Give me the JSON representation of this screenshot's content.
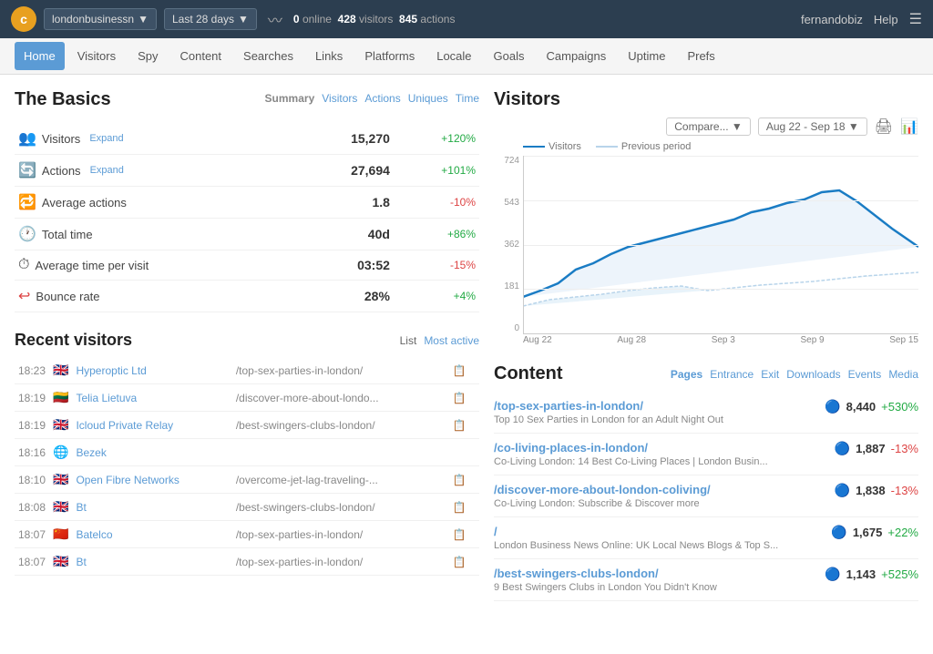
{
  "topnav": {
    "logo": "c",
    "site": "londonbusinessn",
    "date_range": "Last 28 days",
    "online": "0",
    "visitors": "428",
    "actions": "845",
    "online_label": "online",
    "visitors_label": "visitors",
    "actions_label": "actions",
    "user": "fernandobiz",
    "help": "Help"
  },
  "subnav": {
    "items": [
      {
        "label": "Home",
        "active": true
      },
      {
        "label": "Visitors",
        "active": false
      },
      {
        "label": "Spy",
        "active": false
      },
      {
        "label": "Content",
        "active": false
      },
      {
        "label": "Searches",
        "active": false
      },
      {
        "label": "Links",
        "active": false
      },
      {
        "label": "Platforms",
        "active": false
      },
      {
        "label": "Locale",
        "active": false
      },
      {
        "label": "Goals",
        "active": false
      },
      {
        "label": "Campaigns",
        "active": false
      },
      {
        "label": "Uptime",
        "active": false
      },
      {
        "label": "Prefs",
        "active": false
      }
    ]
  },
  "basics": {
    "title": "The Basics",
    "summary_label": "Summary",
    "tabs": [
      "Visitors",
      "Actions",
      "Uniques",
      "Time"
    ],
    "metrics": [
      {
        "icon": "visitors",
        "label": "Visitors",
        "expand": true,
        "value": "15,270",
        "change": "+120%",
        "positive": true
      },
      {
        "icon": "actions",
        "label": "Actions",
        "expand": true,
        "value": "27,694",
        "change": "+101%",
        "positive": true
      },
      {
        "icon": "avg",
        "label": "Average actions",
        "expand": false,
        "value": "1.8",
        "change": "-10%",
        "positive": false
      },
      {
        "icon": "time",
        "label": "Total time",
        "expand": false,
        "value": "40d",
        "change": "+86%",
        "positive": true
      },
      {
        "icon": "time",
        "label": "Average time per visit",
        "expand": false,
        "value": "03:52",
        "change": "-15%",
        "positive": false
      },
      {
        "icon": "bounce",
        "label": "Bounce rate",
        "expand": false,
        "value": "28%",
        "change": "+4%",
        "positive": true
      }
    ]
  },
  "recent_visitors": {
    "title": "Recent visitors",
    "list_label": "List",
    "most_active_label": "Most active",
    "rows": [
      {
        "time": "18:23",
        "flag": "🇬🇧",
        "name": "Hyperoptic Ltd",
        "url": "/top-sex-parties-in-london/"
      },
      {
        "time": "18:19",
        "flag": "🇱🇹",
        "name": "Telia Lietuva",
        "url": "/discover-more-about-londo..."
      },
      {
        "time": "18:19",
        "flag": "🇬🇧",
        "name": "Icloud Private Relay",
        "url": "/best-swingers-clubs-london/"
      },
      {
        "time": "18:16",
        "flag": "🌐",
        "name": "Bezek",
        "url": ""
      },
      {
        "time": "18:10",
        "flag": "🇬🇧",
        "name": "Open Fibre Networks",
        "url": "/overcome-jet-lag-traveling-..."
      },
      {
        "time": "18:08",
        "flag": "🇬🇧",
        "name": "Bt",
        "url": "/best-swingers-clubs-london/"
      },
      {
        "time": "18:07",
        "flag": "🇨🇳",
        "name": "Batelco",
        "url": "/top-sex-parties-in-london/"
      },
      {
        "time": "18:07",
        "flag": "🇬🇧",
        "name": "Bt",
        "url": "/top-sex-parties-in-london/"
      }
    ]
  },
  "visitors_chart": {
    "title": "Visitors",
    "compare_label": "Compare...",
    "date_range": "Aug 22 - Sep 18",
    "legend_visitors": "Visitors",
    "legend_prev": "Previous period",
    "y_labels": [
      "724",
      "543",
      "362",
      "181",
      "0"
    ],
    "x_labels": [
      "Aug 22",
      "Aug 28",
      "Sep 3",
      "Sep 9",
      "Sep 15"
    ]
  },
  "content": {
    "title": "Content",
    "tabs": [
      "Pages",
      "Entrance",
      "Exit",
      "Downloads",
      "Events",
      "Media"
    ],
    "items": [
      {
        "url": "/top-sex-parties-in-london/",
        "desc": "Top 10 Sex Parties in London for an Adult Night Out",
        "count": "8,440",
        "change": "+530%",
        "positive": true
      },
      {
        "url": "/co-living-places-in-london/",
        "desc": "Co-Living London: 14 Best Co-Living Places | London Busin...",
        "count": "1,887",
        "change": "-13%",
        "positive": false
      },
      {
        "url": "/discover-more-about-london-coliving/",
        "desc": "Co-Living London: Subscribe & Discover more",
        "count": "1,838",
        "change": "-13%",
        "positive": false
      },
      {
        "url": "/",
        "desc": "London Business News Online: UK Local News Blogs & Top S...",
        "count": "1,675",
        "change": "+22%",
        "positive": true
      },
      {
        "url": "/best-swingers-clubs-london/",
        "desc": "9 Best Swingers Clubs in London You Didn't Know",
        "count": "1,143",
        "change": "+525%",
        "positive": true
      }
    ]
  }
}
